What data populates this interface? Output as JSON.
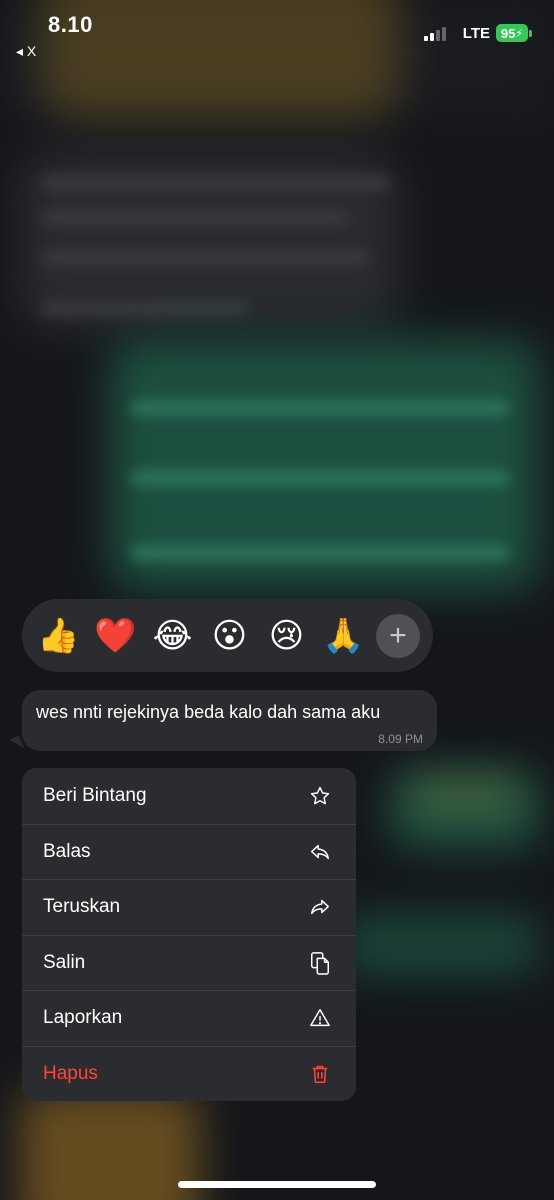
{
  "status_bar": {
    "time": "8.10",
    "back_label": "◂ X",
    "network": "LTE",
    "battery": "95"
  },
  "reactions": {
    "emojis": [
      {
        "glyph": "👍",
        "name": "thumbs-up"
      },
      {
        "glyph": "❤️",
        "name": "heart"
      },
      {
        "glyph": "😂",
        "name": "tears-of-joy"
      },
      {
        "glyph": "😮",
        "name": "surprised"
      },
      {
        "glyph": "😢",
        "name": "crying"
      },
      {
        "glyph": "🙏",
        "name": "pray"
      }
    ],
    "more_label": "+"
  },
  "message": {
    "text": "wes nnti rejekinya beda kalo dah sama aku",
    "time": "8.09 PM"
  },
  "menu": {
    "items": [
      {
        "label": "Beri Bintang",
        "icon": "star-icon"
      },
      {
        "label": "Balas",
        "icon": "reply-icon"
      },
      {
        "label": "Teruskan",
        "icon": "forward-icon"
      },
      {
        "label": "Salin",
        "icon": "copy-icon"
      },
      {
        "label": "Laporkan",
        "icon": "warning-icon"
      },
      {
        "label": "Hapus",
        "icon": "trash-icon"
      }
    ]
  },
  "colors": {
    "danger": "#ff453a",
    "battery": "#37c759",
    "surface": "#2b2c30"
  }
}
